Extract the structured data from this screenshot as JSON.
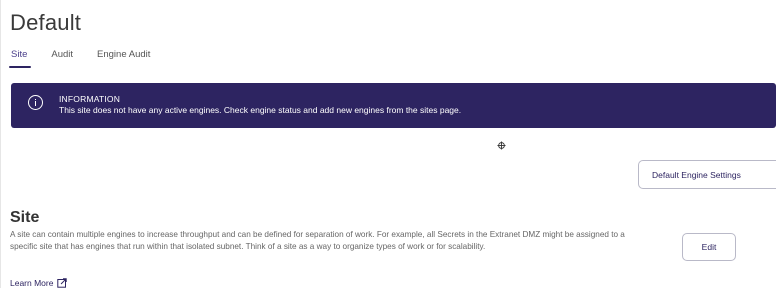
{
  "page": {
    "title": "Default"
  },
  "tabs": [
    {
      "label": "Site",
      "active": true
    },
    {
      "label": "Audit",
      "active": false
    },
    {
      "label": "Engine Audit",
      "active": false
    }
  ],
  "info_banner": {
    "icon": "info-icon",
    "title": "INFORMATION",
    "message": "This site does not have any active engines. Check engine status and add new engines from the sites page."
  },
  "buttons": {
    "default_engine_settings": "Default Engine Settings",
    "edit": "Edit"
  },
  "site_section": {
    "title": "Site",
    "description": "A site can contain multiple engines to increase throughput and can be defined for separation of work. For example, all Secrets in the Extranet DMZ might be assigned to a specific site that has engines that run within that isolated subnet. Think of a site as a way to organize types of work or for scalability.",
    "learn_more": "Learn More"
  },
  "colors": {
    "brand": "#2d2461",
    "banner_text": "#ffffff",
    "body_text": "#666666"
  }
}
